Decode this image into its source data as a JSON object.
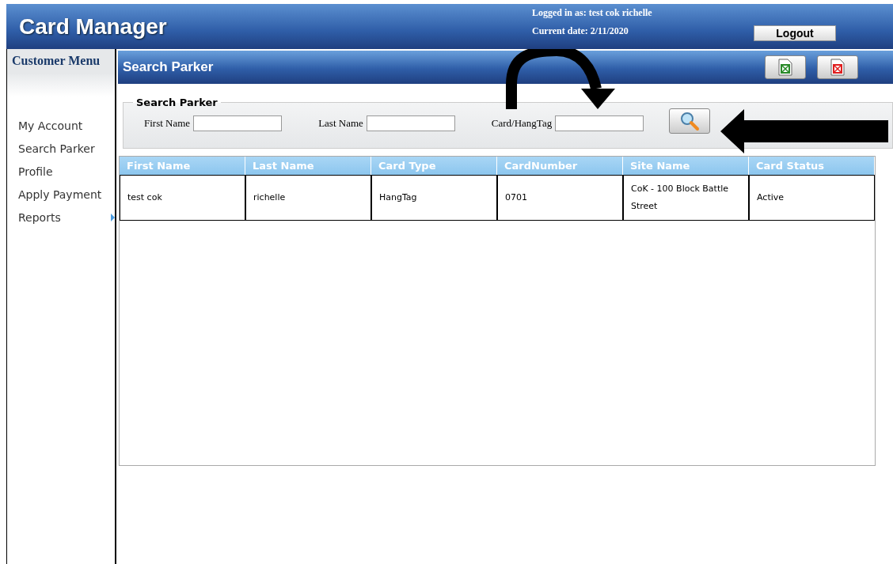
{
  "header": {
    "title": "Card Manager",
    "logged_in": "Logged in as: test cok richelle",
    "current_date": "Current date: 2/11/2020",
    "logout": "Logout"
  },
  "sidebar": {
    "title": "Customer Menu",
    "items": [
      {
        "label": "My Account",
        "has_submenu": false
      },
      {
        "label": "Search Parker",
        "has_submenu": false
      },
      {
        "label": "Profile",
        "has_submenu": false
      },
      {
        "label": "Apply Payment",
        "has_submenu": false
      },
      {
        "label": "Reports",
        "has_submenu": true
      }
    ]
  },
  "panel": {
    "title": "Search Parker"
  },
  "search": {
    "legend": "Search Parker",
    "fields": [
      {
        "label": "First Name"
      },
      {
        "label": "Last Name"
      },
      {
        "label": "Card/HangTag"
      }
    ]
  },
  "table": {
    "columns": [
      "First Name",
      "Last Name",
      "Card Type",
      "CardNumber",
      "Site Name",
      "Card Status"
    ],
    "rows": [
      [
        "test cok",
        "richelle",
        "HangTag",
        "0701",
        "CoK - 100 Block Battle Street",
        "Active"
      ]
    ]
  }
}
